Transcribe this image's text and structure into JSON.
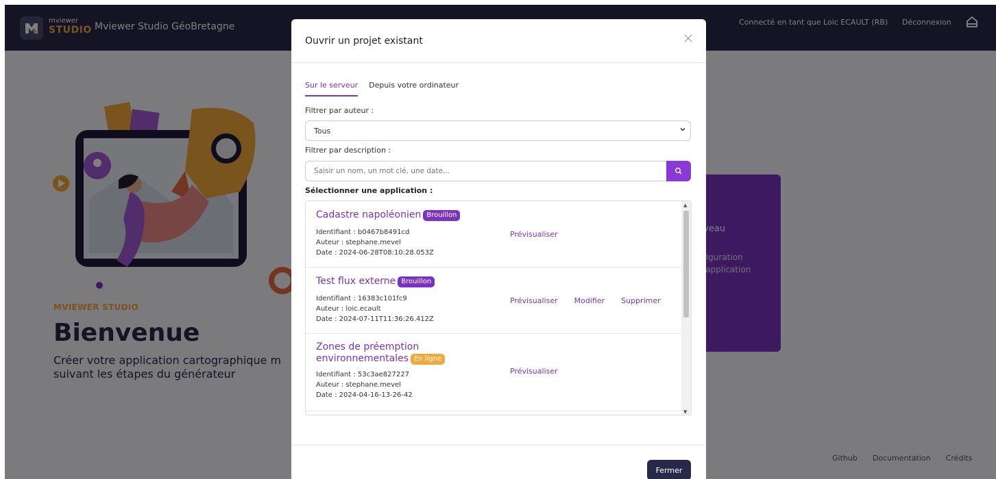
{
  "navbar": {
    "logo_small": "mviewer",
    "logo_big": "STUDIO",
    "app_title": "Mviewer Studio GéoBretagne",
    "user_label": "Connecté en tant que Loic ECAULT (RB)",
    "logout_label": "Déconnexion",
    "home_icon": "home-icon"
  },
  "page": {
    "studio_label": "MVIEWER STUDIO",
    "welcome": "Bienvenue",
    "description_line1": "Créer votre application cartographique m",
    "description_line2": "suivant les étapes du générateur",
    "card_title": "uveau",
    "card_text_line1": "nfiguration",
    "card_text_line2": "e application",
    "footer_links": [
      "Github",
      "Documentation",
      "Crédits"
    ]
  },
  "modal": {
    "title": "Ouvrir un projet existant",
    "close_icon": "close-icon",
    "tabs": [
      {
        "label": "Sur le serveur",
        "active": true
      },
      {
        "label": "Depuis votre ordinateur",
        "active": false
      }
    ],
    "author_filter_label": "Filtrer par auteur :",
    "author_filter_value": "Tous",
    "description_filter_label": "Filtrer par description :",
    "search_placeholder": "Saisir un nom, un mot clé, une date...",
    "select_label": "Sélectionner une application :",
    "items": [
      {
        "title": "Cadastre napoléonien",
        "badge": "Brouillon",
        "identifier": "Identifiant : b0467b8491cd",
        "author": "Auteur : stephane.mevel",
        "date": "Date : 2024-06-28T08:10:28.053Z",
        "actions": [
          "Prévisualiser"
        ]
      },
      {
        "title": "Test flux externe",
        "badge": "Brouillon",
        "identifier": "Identifiant : 16383c101fc9",
        "author": "Auteur : loic.ecault",
        "date": "Date : 2024-07-11T11:36:26.412Z",
        "actions": [
          "Prévisualiser",
          "Modifier",
          "Supprimer"
        ]
      },
      {
        "title_line1": "Zones de préemption",
        "title_line2": "environnementales",
        "badge": "En ligne",
        "identifier": "Identifiant : 53c3ae827227",
        "author": "Auteur : stephane.mevel",
        "date": "Date : 2024-04-16-13-26-42",
        "actions": [
          "Prévisualiser"
        ]
      }
    ],
    "close_button": "Fermer"
  },
  "colors": {
    "navbar_bg": "#28284a",
    "accent_purple": "#7b32c2",
    "accent_orange": "#f2a93b"
  }
}
